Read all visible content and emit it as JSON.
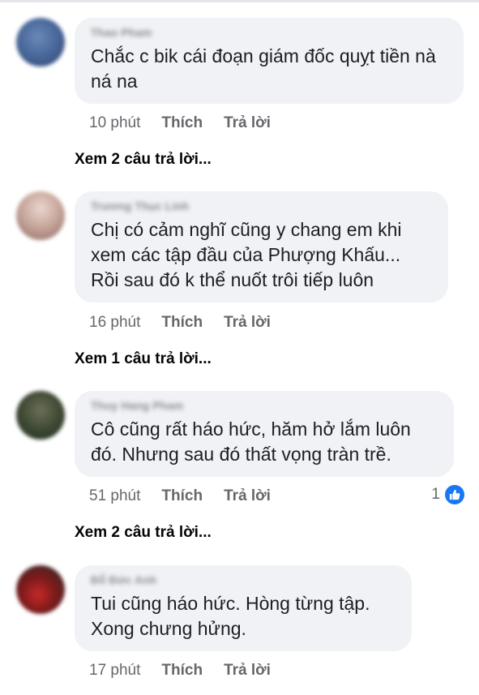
{
  "comments": [
    {
      "name": "Thao Pham",
      "text": "Chắc c bik cái đoạn giám đốc quỵt tiền nà ná na",
      "time": "10 phút",
      "like_label": "Thích",
      "reply_label": "Trả lời",
      "view_replies": "Xem 2 câu trả lời..."
    },
    {
      "name": "Trương Thục Linh",
      "text": "Chị có cảm nghĩ cũng y chang em khi xem các tập đầu của Phượng Khấu... Rồi sau đó k thể nuốt trôi tiếp luôn",
      "time": "16 phút",
      "like_label": "Thích",
      "reply_label": "Trả lời",
      "view_replies": "Xem 1 câu trả lời..."
    },
    {
      "name": "Thuy Hang Pham",
      "text": "Cô cũng rất háo hức, hăm hở lắm luôn đó. Nhưng sau đó thất vọng tràn trề.",
      "time": "51 phút",
      "like_label": "Thích",
      "reply_label": "Trả lời",
      "reaction_count": "1",
      "view_replies": "Xem 2 câu trả lời..."
    },
    {
      "name": "Đỗ Đức Anh",
      "text": "Tui cũng háo hức. Hòng từng tập. Xong chưng hửng.",
      "time": "17 phút",
      "like_label": "Thích",
      "reply_label": "Trả lời"
    }
  ],
  "icons": {
    "reaction": "like-thumb-icon"
  },
  "colors": {
    "bubble": "#f0f2f5",
    "meta": "#65676b",
    "like_blue": "#1877f2"
  }
}
